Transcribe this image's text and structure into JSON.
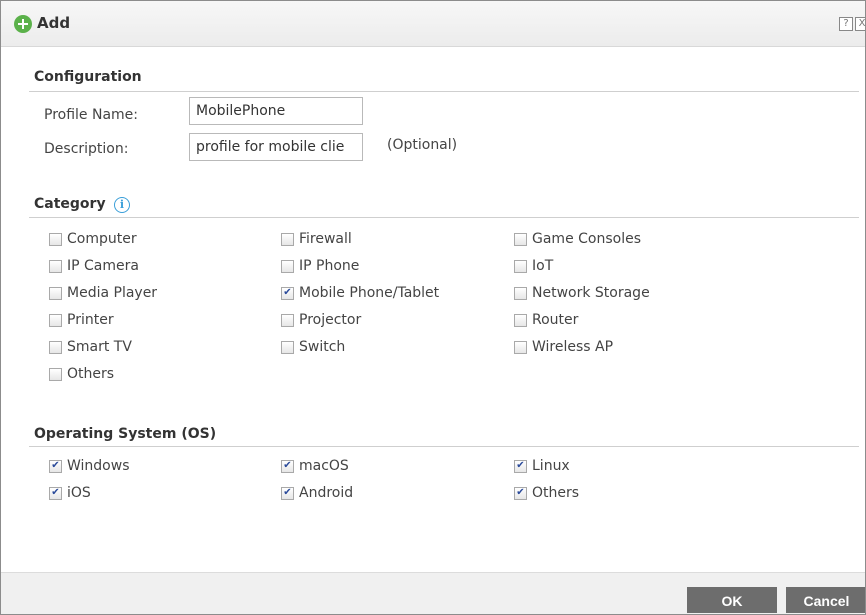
{
  "title": "Add",
  "icons": {
    "title": "add-circle-icon",
    "help": "help-icon",
    "close": "close-icon",
    "info": "info-icon"
  },
  "titlebar": {
    "help_glyph": "?",
    "close_glyph": "X"
  },
  "configuration": {
    "heading": "Configuration",
    "profile_name_label": "Profile Name:",
    "profile_name_value": "MobilePhone",
    "description_label": "Description:",
    "description_value": "profile for mobile clie",
    "optional_text": "(Optional)"
  },
  "category": {
    "heading": "Category",
    "info_glyph": "i",
    "items": [
      {
        "label": "Computer",
        "checked": false
      },
      {
        "label": "Firewall",
        "checked": false
      },
      {
        "label": "Game Consoles",
        "checked": false
      },
      {
        "label": "IP Camera",
        "checked": false
      },
      {
        "label": "IP Phone",
        "checked": false
      },
      {
        "label": "IoT",
        "checked": false
      },
      {
        "label": "Media Player",
        "checked": false
      },
      {
        "label": "Mobile Phone/Tablet",
        "checked": true
      },
      {
        "label": "Network Storage",
        "checked": false
      },
      {
        "label": "Printer",
        "checked": false
      },
      {
        "label": "Projector",
        "checked": false
      },
      {
        "label": "Router",
        "checked": false
      },
      {
        "label": "Smart TV",
        "checked": false
      },
      {
        "label": "Switch",
        "checked": false
      },
      {
        "label": "Wireless AP",
        "checked": false
      },
      {
        "label": "Others",
        "checked": false
      }
    ]
  },
  "os": {
    "heading": "Operating System (OS)",
    "items": [
      {
        "label": "Windows",
        "checked": true
      },
      {
        "label": "macOS",
        "checked": true
      },
      {
        "label": "Linux",
        "checked": true
      },
      {
        "label": "iOS",
        "checked": true
      },
      {
        "label": "Android",
        "checked": true
      },
      {
        "label": "Others",
        "checked": true
      }
    ]
  },
  "buttons": {
    "ok": "OK",
    "cancel": "Cancel"
  },
  "colors": {
    "accent_green": "#5bb14a",
    "info_blue": "#3b9fd9",
    "button_gray": "#6d6d6d"
  }
}
